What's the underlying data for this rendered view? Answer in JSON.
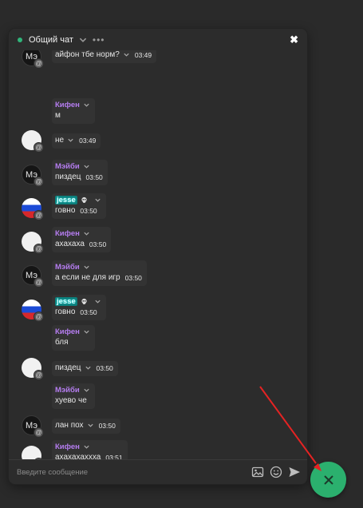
{
  "header": {
    "title": "Общий чат",
    "menu_dots": "•••",
    "close": "✖"
  },
  "composer": {
    "placeholder": "Введите сообщение"
  },
  "colors": {
    "accent": "#2bb06e",
    "username": "#b57df0",
    "arrow": "#e52323"
  },
  "icons": {
    "image": "image-icon",
    "emoji": "emoji-icon",
    "send": "send-icon",
    "close": "close-icon"
  },
  "messages": [
    {
      "avatar": "Мэ",
      "text": "айфон тбе норм?",
      "time": "03:49"
    },
    {
      "name": "Кифен",
      "text": "м"
    },
    {
      "text": "не",
      "time": "03:49"
    },
    {
      "avatar": "Мэ",
      "name": "Мэйби",
      "text": "пиздец",
      "time": "03:50"
    },
    {
      "name": "jesse",
      "text": "говно",
      "time": "03:50"
    },
    {
      "name": "Кифен",
      "text": "ахахаха",
      "time": "03:50"
    },
    {
      "avatar": "Мэ",
      "name": "Мэйби",
      "text": "а если не для игр",
      "time": "03:50"
    },
    {
      "name": "jesse",
      "text": "говно",
      "time": "03:50"
    },
    {
      "name": "Кифен",
      "text": "бля"
    },
    {
      "text": "пиздец",
      "time": "03:50"
    },
    {
      "name": "Мэйби",
      "text": "хуево че"
    },
    {
      "avatar": "Мэ",
      "text": "лан пох",
      "time": "03:50"
    },
    {
      "name": "Кифен",
      "text": "ахахахаххха",
      "time": "03:51"
    }
  ]
}
